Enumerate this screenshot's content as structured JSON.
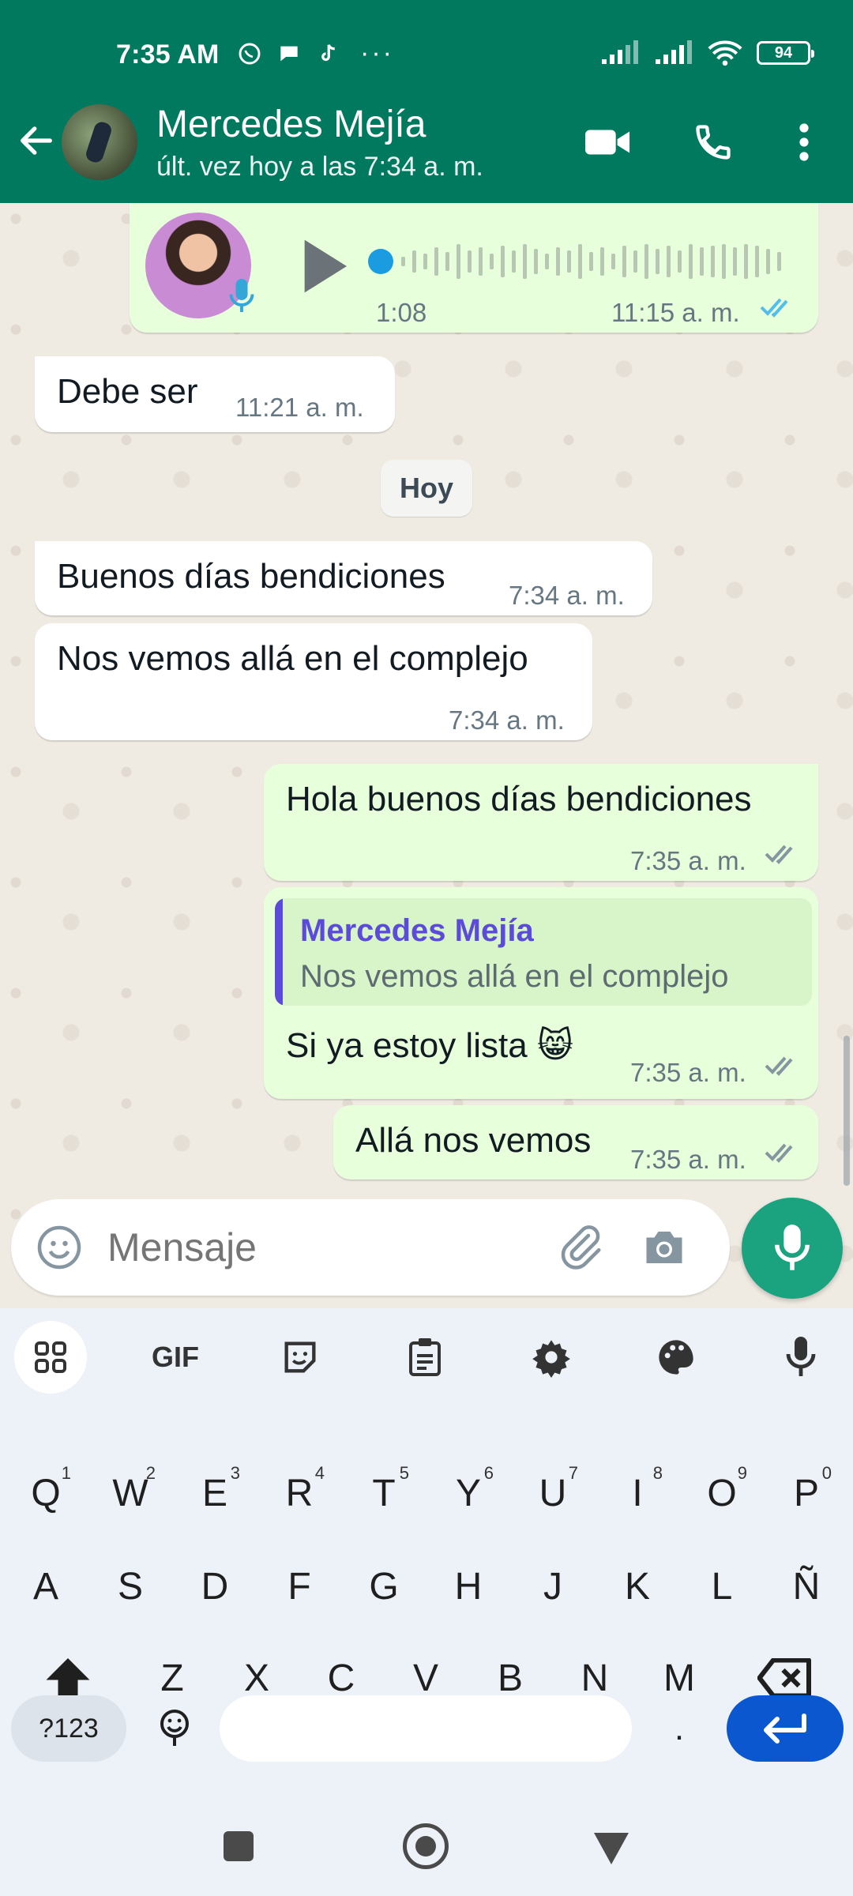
{
  "status_bar": {
    "time": "7:35 AM",
    "battery": "94",
    "more": "···"
  },
  "header": {
    "name": "Mercedes Mejía",
    "status": "últ. vez hoy a las 7:34 a. m."
  },
  "messages": {
    "voice": {
      "duration": "1:08",
      "time": "11:15 a. m."
    },
    "m1": {
      "text": "Debe ser",
      "time": "11:21 a. m."
    },
    "date_chip": "Hoy",
    "m2": {
      "text": "Buenos días bendiciones",
      "time": "7:34 a. m."
    },
    "m3": {
      "text": "Nos vemos allá en el complejo",
      "time": "7:34 a. m."
    },
    "m4": {
      "text": "Hola buenos días bendiciones",
      "time": "7:35 a. m."
    },
    "m5": {
      "reply_name": "Mercedes Mejía",
      "reply_text": "Nos vemos allá en el complejo",
      "text": "Si ya estoy lista 😸",
      "time": "7:35 a. m."
    },
    "m6": {
      "text": "Allá nos vemos",
      "time": "7:35 a. m."
    }
  },
  "composer": {
    "placeholder": "Mensaje"
  },
  "keyboard": {
    "toolbar": [
      "apps-icon",
      "gif",
      "sticker-icon",
      "clipboard-icon",
      "settings-icon",
      "palette-icon",
      "voice-icon"
    ],
    "gif_label": "GIF",
    "row1": [
      {
        "k": "Q",
        "n": "1"
      },
      {
        "k": "W",
        "n": "2"
      },
      {
        "k": "E",
        "n": "3"
      },
      {
        "k": "R",
        "n": "4"
      },
      {
        "k": "T",
        "n": "5"
      },
      {
        "k": "Y",
        "n": "6"
      },
      {
        "k": "U",
        "n": "7"
      },
      {
        "k": "I",
        "n": "8"
      },
      {
        "k": "O",
        "n": "9"
      },
      {
        "k": "P",
        "n": "0"
      }
    ],
    "row2": [
      "A",
      "S",
      "D",
      "F",
      "G",
      "H",
      "J",
      "K",
      "L",
      "Ñ"
    ],
    "row3": [
      "Z",
      "X",
      "C",
      "V",
      "B",
      "N",
      "M"
    ],
    "symbols": "?123",
    "period": "."
  },
  "colors": {
    "header": "#00795f",
    "outgoing": "#e7ffdb",
    "incoming": "#ffffff",
    "accent": "#1aa37e",
    "read_ticks": "#53bdeb",
    "enter": "#0b57d0"
  }
}
